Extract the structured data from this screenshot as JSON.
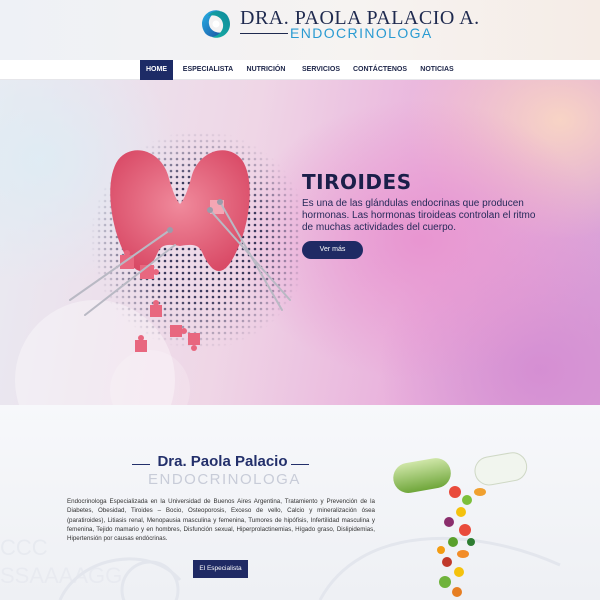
{
  "brand": {
    "name": "DRA. PAOLA PALACIO A.",
    "subtitle": "ENDOCRINOLOGA"
  },
  "nav": {
    "items": [
      {
        "label": "HOME",
        "active": true
      },
      {
        "label": "ESPECIALISTA",
        "active": false
      },
      {
        "label": "NUTRICIÓN",
        "active": false
      },
      {
        "label": "SERVICIOS",
        "active": false
      },
      {
        "label": "CONTÁCTENOS",
        "active": false
      },
      {
        "label": "NOTICIAS",
        "active": false
      }
    ]
  },
  "hero": {
    "title": "TIROIDES",
    "text": "Es una de las glándulas endocrinas que producen hormonas. Las hormonas tiroideas controlan el ritmo de muchas actividades del cuerpo.",
    "button": "Ver más"
  },
  "about": {
    "title": "Dra. Paola Palacio",
    "subtitle": "ENDOCRINOLOGA",
    "text": "Endocrinologa Especializada en la Universidad de Buenos Aires Argentina, Tratamiento y Prevención de la Diabetes, Obesidad, Tiroides – Bocio, Osteoporosis, Exceso de vello, Calcio y mineralización ósea (paratiroides), Litiasis renal, Menopausia masculina y femenina, Tumores de hipófisis, Infertilidad masculina y femenina, Tejido mamario y en hombres, Disfunción sexual, Hiperprolactinemias, Hígado graso, Dislipidemias, Hipertensión por causas endócrinas.",
    "button": "El Especialista"
  },
  "colors": {
    "navy": "#1d2b66",
    "brand_blue": "#2a9bd2",
    "thyroid_pink": "#e8677f"
  }
}
